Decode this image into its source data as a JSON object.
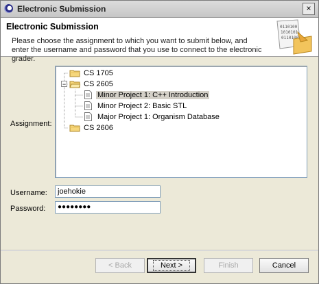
{
  "window": {
    "title": "Electronic Submission",
    "close_label": "×"
  },
  "banner": {
    "title": "Electronic Submission",
    "description": "Please choose the assignment to which you want to submit below, and enter the username and password that you use to connect to the electronic grader.",
    "art_digits": [
      "0110100",
      "1010101",
      "0110100"
    ]
  },
  "form": {
    "assignment_label": "Assignment:",
    "username_label": "Username:",
    "password_label": "Password:",
    "username_value": "joehokie",
    "password_value": "●●●●●●●●"
  },
  "tree": {
    "nodes": [
      {
        "label": "CS 1705",
        "type": "folder",
        "expanded": false
      },
      {
        "label": "CS 2605",
        "type": "folder",
        "expanded": true,
        "children": [
          {
            "label": "Minor Project 1: C++ Introduction",
            "type": "document",
            "selected": true
          },
          {
            "label": "Minor Project 2: Basic STL",
            "type": "document"
          },
          {
            "label": "Major Project 1: Organism Database",
            "type": "document"
          }
        ]
      },
      {
        "label": "CS 2606",
        "type": "folder",
        "expanded": false
      }
    ],
    "expand_symbol": "−"
  },
  "buttons": {
    "back": "< Back",
    "next": "Next >",
    "finish": "Finish",
    "cancel": "Cancel"
  },
  "colors": {
    "folder_fill": "#f6d77c",
    "folder_stroke": "#b08a2c",
    "selection": "#d4d0c8",
    "input_border": "#7f9db9"
  }
}
